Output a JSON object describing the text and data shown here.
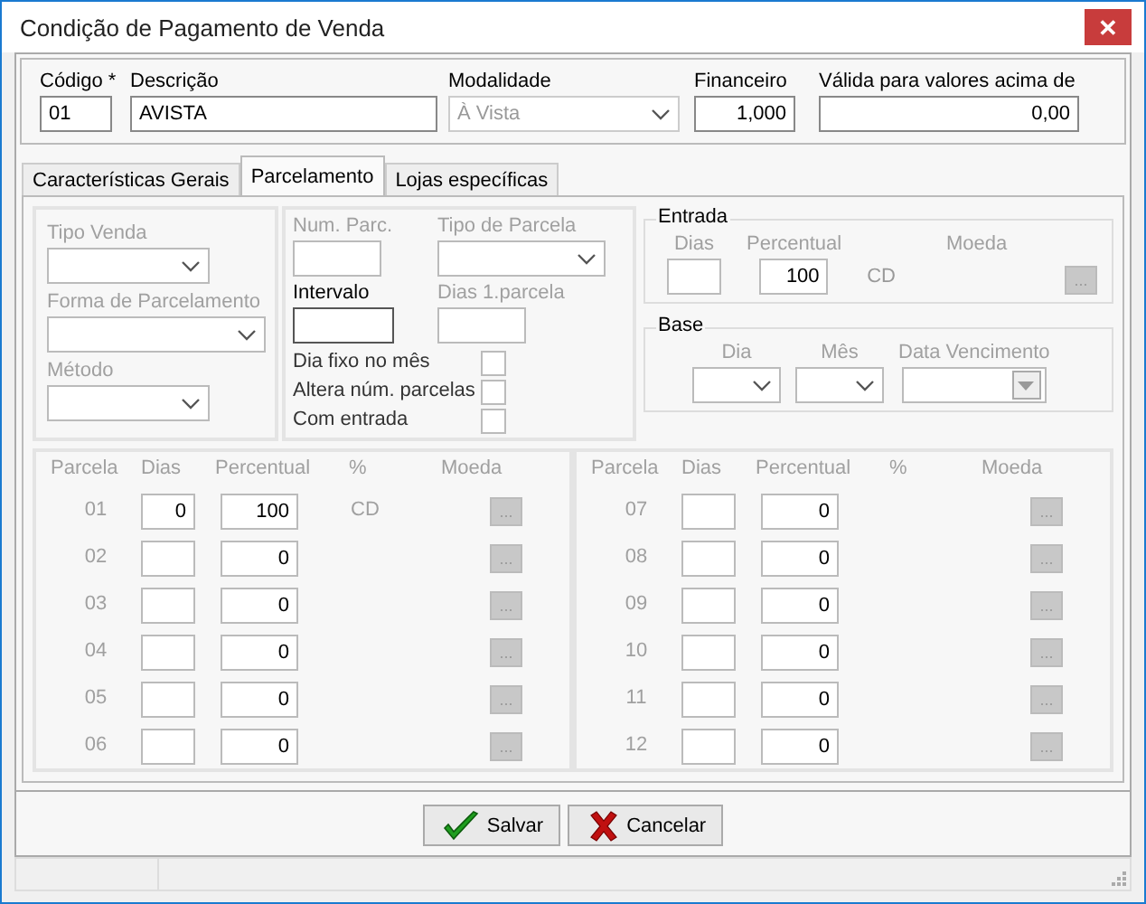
{
  "window": {
    "title": "Condição de Pagamento de Venda",
    "close": "✕"
  },
  "header": {
    "fields": [
      {
        "label": "Código *",
        "value": "01",
        "kind": "text",
        "disabled": false
      },
      {
        "label": "Descrição",
        "value": "AVISTA",
        "kind": "text",
        "disabled": false
      },
      {
        "label": "Modalidade",
        "value": "À Vista",
        "kind": "select",
        "disabled": true
      },
      {
        "label": "Financeiro",
        "value": "1,000",
        "kind": "number",
        "disabled": false
      },
      {
        "label": "Válida para valores acima de",
        "value": "0,00",
        "kind": "number",
        "disabled": false
      }
    ]
  },
  "tabs": [
    {
      "label": "Características Gerais",
      "selected": false
    },
    {
      "label": "Parcelamento",
      "selected": true
    },
    {
      "label": "Lojas específicas",
      "selected": false
    }
  ],
  "left_fields": [
    {
      "label": "Tipo Venda",
      "disabled": true
    },
    {
      "label": "Forma de Parcelamento",
      "disabled": true
    },
    {
      "label": "Método",
      "disabled": true
    }
  ],
  "middle_fields": [
    {
      "label": "Num. Parc.",
      "kind": "text",
      "disabled": true
    },
    {
      "label": "Tipo de Parcela",
      "kind": "select",
      "disabled": true
    },
    {
      "label": "Intervalo",
      "kind": "text",
      "disabled": false
    },
    {
      "label": "Dias 1.parcela",
      "kind": "text",
      "disabled": true
    }
  ],
  "checkboxes": [
    {
      "label": "Dia fixo no mês",
      "checked": false
    },
    {
      "label": "Altera núm. parcelas",
      "checked": false
    },
    {
      "label": "Com entrada",
      "checked": false
    }
  ],
  "entrada": {
    "title": "Entrada",
    "dias_label": "Dias",
    "percentual_label": "Percentual",
    "percentual": "100",
    "moeda_label": "Moeda",
    "moeda": "CD",
    "button": "..."
  },
  "base": {
    "title": "Base",
    "fields": [
      {
        "label": "Dia",
        "kind": "select"
      },
      {
        "label": "Mês",
        "kind": "select"
      },
      {
        "label": "Data Vencimento",
        "kind": "date"
      }
    ]
  },
  "installments": [
    {
      "headers": [
        "Parcela",
        "Dias",
        "Percentual",
        "%",
        "Moeda"
      ],
      "rows": [
        {
          "parcela": "01",
          "dias": "0",
          "percentual": "100",
          "moeda": "CD",
          "button": "..."
        },
        {
          "parcela": "02",
          "percentual": "0",
          "button": "..."
        },
        {
          "parcela": "03",
          "percentual": "0",
          "button": "..."
        },
        {
          "parcela": "04",
          "percentual": "0",
          "button": "..."
        },
        {
          "parcela": "05",
          "percentual": "0",
          "button": "..."
        },
        {
          "parcela": "06",
          "percentual": "0",
          "button": "..."
        }
      ]
    },
    {
      "headers": [
        "Parcela",
        "Dias",
        "Percentual",
        "%",
        "Moeda"
      ],
      "rows": [
        {
          "parcela": "07",
          "percentual": "0",
          "button": "..."
        },
        {
          "parcela": "08",
          "percentual": "0",
          "button": "..."
        },
        {
          "parcela": "09",
          "percentual": "0",
          "button": "..."
        },
        {
          "parcela": "10",
          "percentual": "0",
          "button": "..."
        },
        {
          "parcela": "11",
          "percentual": "0",
          "button": "..."
        },
        {
          "parcela": "12",
          "percentual": "0",
          "button": "..."
        }
      ]
    }
  ],
  "buttons": [
    {
      "label": "Salvar",
      "kind": "save"
    },
    {
      "label": "Cancelar",
      "kind": "cancel"
    }
  ]
}
